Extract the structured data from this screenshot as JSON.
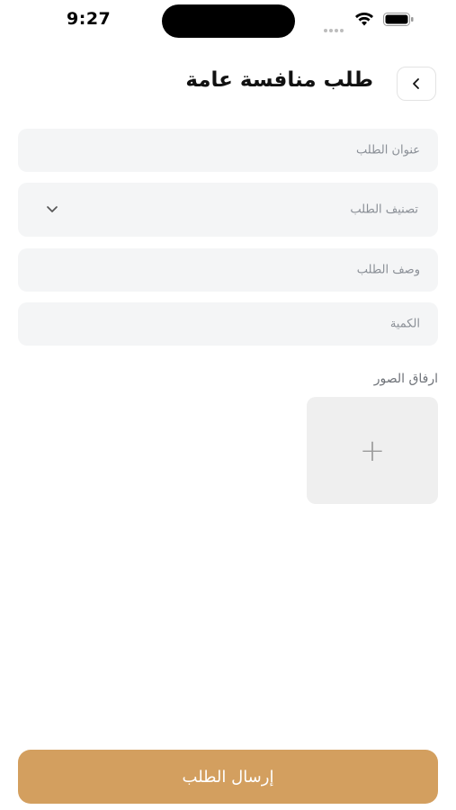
{
  "status_bar": {
    "time": "9:27"
  },
  "header": {
    "title": "طلب منافسة عامة"
  },
  "form": {
    "title_placeholder": "عنوان الطلب",
    "category_placeholder": "تصنيف الطلب",
    "description_placeholder": "وصف الطلب",
    "quantity_placeholder": "الكمية",
    "attach_label": "ارفاق الصور",
    "add_symbol": "+"
  },
  "actions": {
    "submit_label": "إرسال الطلب"
  },
  "colors": {
    "accent": "#d39f5f",
    "field_bg": "#f4f5f6",
    "placeholder": "#8a8f96"
  },
  "icons": {
    "back": "chevron-left-icon",
    "dropdown": "chevron-down-icon",
    "add": "plus-icon",
    "wifi": "wifi-icon",
    "battery": "battery-icon",
    "signal": "signal-icon"
  }
}
